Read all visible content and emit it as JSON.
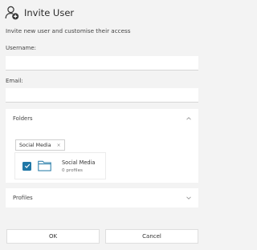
{
  "dialog": {
    "title": "Invite User",
    "description": "Invite new user and customise their access"
  },
  "form": {
    "username_label": "Username:",
    "username_value": "",
    "email_label": "Email:",
    "email_value": ""
  },
  "folders_panel": {
    "label": "Folders",
    "expanded": true,
    "selected_chip": "Social Media",
    "chip_close": "×",
    "items": [
      {
        "name": "Social Media",
        "count": "0 profiles",
        "checked": true
      }
    ]
  },
  "profiles_panel": {
    "label": "Profiles",
    "expanded": false
  },
  "buttons": {
    "ok": "OK",
    "cancel": "Cancel"
  },
  "colors": {
    "background": "#f3f3f3",
    "accent": "#1f77a6"
  },
  "icons": {
    "title_icon": "add-user-icon",
    "folders_toggle": "chevron-up-icon",
    "profiles_toggle": "chevron-down-icon",
    "folder": "folder-icon",
    "checkbox": "check-icon"
  }
}
